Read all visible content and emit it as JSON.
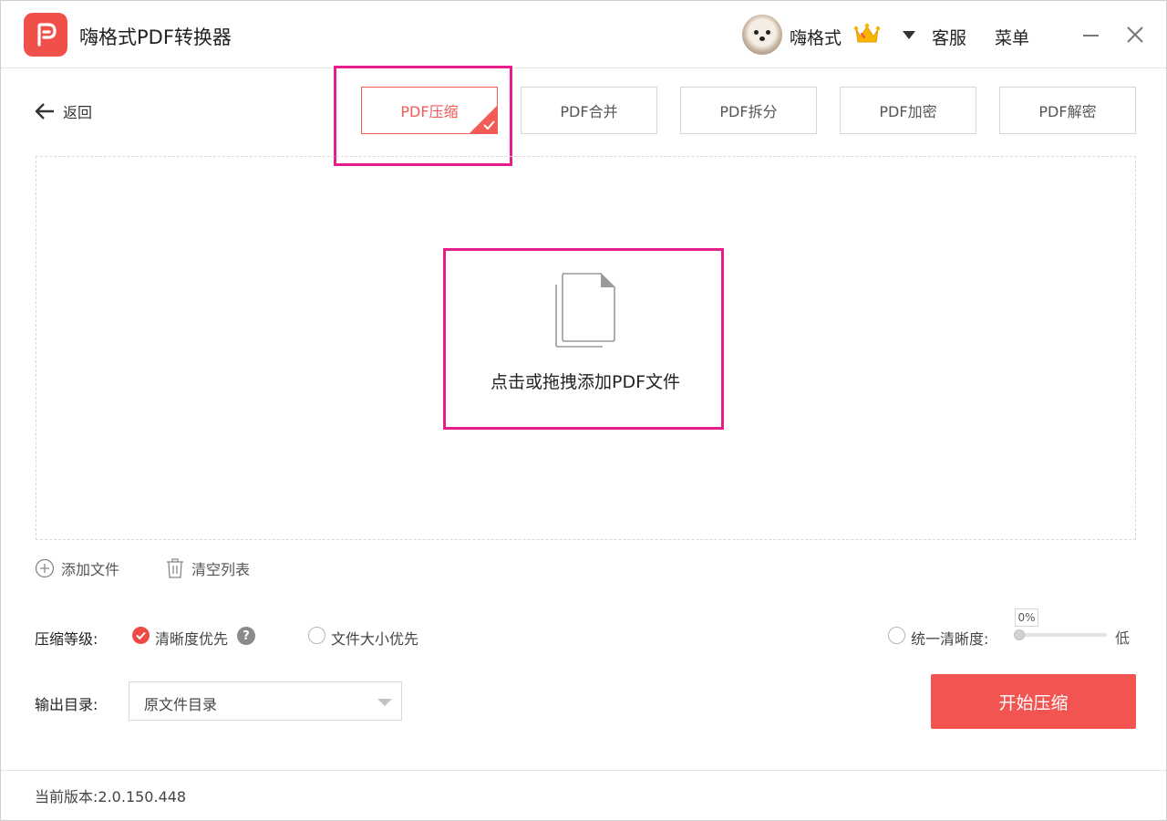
{
  "app": {
    "title": "嗨格式PDF转换器",
    "accent_color": "#f15451",
    "highlight_color": "#e61e8c"
  },
  "header": {
    "username": "嗨格式",
    "service_label": "客服",
    "menu_label": "菜单",
    "icons": [
      "app-logo-icon",
      "crown-icon",
      "chevron-down-icon",
      "minimize-icon",
      "close-icon"
    ]
  },
  "nav": {
    "back_label": "返回",
    "tabs": [
      {
        "label": "PDF压缩",
        "active": true
      },
      {
        "label": "PDF合并",
        "active": false
      },
      {
        "label": "PDF拆分",
        "active": false
      },
      {
        "label": "PDF加密",
        "active": false
      },
      {
        "label": "PDF解密",
        "active": false
      }
    ]
  },
  "dropzone": {
    "prompt": "点击或拖拽添加PDF文件",
    "icon": "document-stack-icon"
  },
  "file_actions": {
    "add_label": "添加文件",
    "clear_label": "清空列表"
  },
  "compression": {
    "label": "压缩等级:",
    "options": [
      {
        "label": "清晰度优先",
        "selected": true
      },
      {
        "label": "文件大小优先",
        "selected": false
      }
    ],
    "help_glyph": "?",
    "uniform_label": "统一清晰度:",
    "slider_value_text": "0%",
    "slider_value": 0,
    "slider_end_label": "低"
  },
  "output": {
    "label": "输出目录:",
    "selected": "原文件目录",
    "start_label": "开始压缩"
  },
  "footer": {
    "version_label": "当前版本:",
    "version": "2.0.150.448"
  }
}
